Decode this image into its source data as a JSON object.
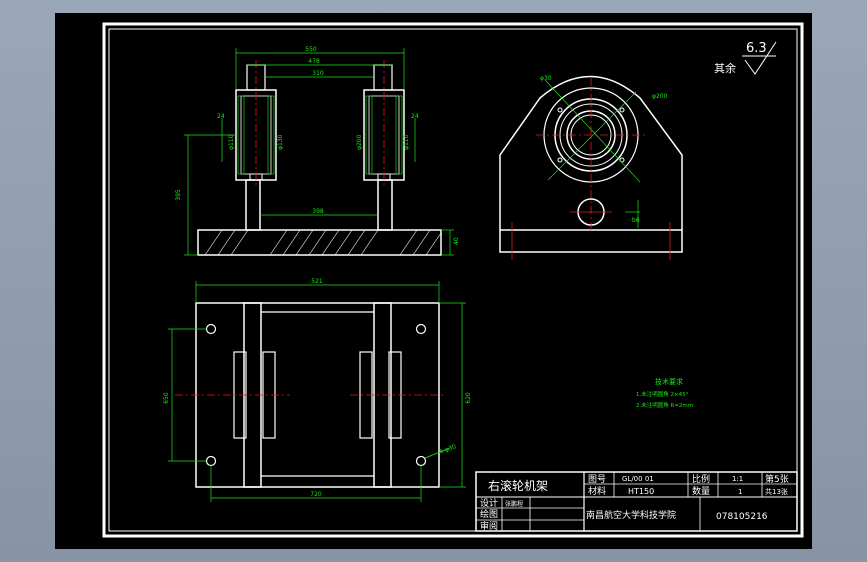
{
  "drawing": {
    "surface_finish": {
      "label": "其余",
      "value": "6.3"
    },
    "front_view": {
      "dims": {
        "overall_width": "550",
        "inner_width_1": "478",
        "inner_width_2": "310",
        "bottom_inner": "398",
        "height": "395",
        "left_24": "24",
        "right_24": "24",
        "bore_labels": [
          "φ110",
          "φ130",
          "φ200"
        ],
        "base_thk": "40"
      }
    },
    "side_view": {
      "dims": {
        "bolt_circle": "φ200",
        "hole_small": "φ30",
        "slot": "b6"
      }
    },
    "plan_view": {
      "dims": {
        "overall_width": "521",
        "bottom_width": "720",
        "left_height": "650",
        "right_height": "620",
        "hole": "4-φ30"
      }
    },
    "tech_requirements": {
      "title": "技术要求",
      "items": [
        "1.未注明圆角 2×45°",
        "2.未注明圆角 R=2mm"
      ]
    },
    "title_block": {
      "part_name": "右滚轮机架",
      "drawing_no_label": "图号",
      "drawing_no": "GL/00 01",
      "scale_label": "比例",
      "scale": "1:1",
      "sheet_label": "第5张",
      "material_label": "材料",
      "material": "HT150",
      "qty_label": "数量",
      "qty": "1",
      "total_label": "共13张",
      "designer_label": "设计",
      "designer": "张鹏程",
      "drafter_label": "绘图",
      "checker_label": "审阅",
      "school": "南昌航空大学科技学院",
      "student_no": "078105216"
    }
  }
}
